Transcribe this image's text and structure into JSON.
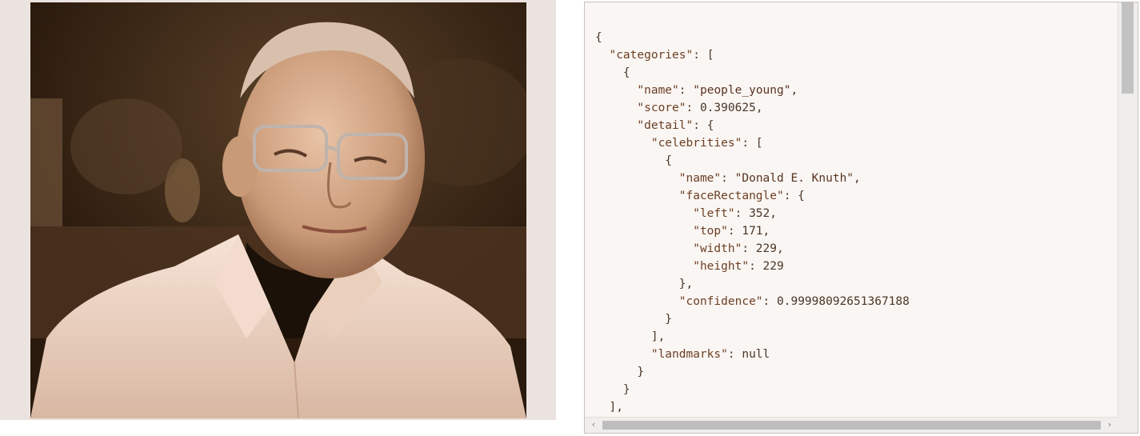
{
  "photo": {
    "subject": "person-portrait"
  },
  "json_viewer": {
    "lines": [
      [
        {
          "t": "p",
          "v": "{"
        }
      ],
      [
        {
          "t": "p",
          "v": "  "
        },
        {
          "t": "k",
          "v": "\"categories\""
        },
        {
          "t": "p",
          "v": ": ["
        }
      ],
      [
        {
          "t": "p",
          "v": "    {"
        }
      ],
      [
        {
          "t": "p",
          "v": "      "
        },
        {
          "t": "k",
          "v": "\"name\""
        },
        {
          "t": "p",
          "v": ": "
        },
        {
          "t": "s",
          "v": "\"people_young\""
        },
        {
          "t": "p",
          "v": ","
        }
      ],
      [
        {
          "t": "p",
          "v": "      "
        },
        {
          "t": "k",
          "v": "\"score\""
        },
        {
          "t": "p",
          "v": ": "
        },
        {
          "t": "n",
          "v": "0.390625"
        },
        {
          "t": "p",
          "v": ","
        }
      ],
      [
        {
          "t": "p",
          "v": "      "
        },
        {
          "t": "k",
          "v": "\"detail\""
        },
        {
          "t": "p",
          "v": ": {"
        }
      ],
      [
        {
          "t": "p",
          "v": "        "
        },
        {
          "t": "k",
          "v": "\"celebrities\""
        },
        {
          "t": "p",
          "v": ": ["
        }
      ],
      [
        {
          "t": "p",
          "v": "          {"
        }
      ],
      [
        {
          "t": "p",
          "v": "            "
        },
        {
          "t": "k",
          "v": "\"name\""
        },
        {
          "t": "p",
          "v": ": "
        },
        {
          "t": "s",
          "v": "\"Donald E. Knuth\""
        },
        {
          "t": "p",
          "v": ","
        }
      ],
      [
        {
          "t": "p",
          "v": "            "
        },
        {
          "t": "k",
          "v": "\"faceRectangle\""
        },
        {
          "t": "p",
          "v": ": {"
        }
      ],
      [
        {
          "t": "p",
          "v": "              "
        },
        {
          "t": "k",
          "v": "\"left\""
        },
        {
          "t": "p",
          "v": ": "
        },
        {
          "t": "n",
          "v": "352"
        },
        {
          "t": "p",
          "v": ","
        }
      ],
      [
        {
          "t": "p",
          "v": "              "
        },
        {
          "t": "k",
          "v": "\"top\""
        },
        {
          "t": "p",
          "v": ": "
        },
        {
          "t": "n",
          "v": "171"
        },
        {
          "t": "p",
          "v": ","
        }
      ],
      [
        {
          "t": "p",
          "v": "              "
        },
        {
          "t": "k",
          "v": "\"width\""
        },
        {
          "t": "p",
          "v": ": "
        },
        {
          "t": "n",
          "v": "229"
        },
        {
          "t": "p",
          "v": ","
        }
      ],
      [
        {
          "t": "p",
          "v": "              "
        },
        {
          "t": "k",
          "v": "\"height\""
        },
        {
          "t": "p",
          "v": ": "
        },
        {
          "t": "n",
          "v": "229"
        }
      ],
      [
        {
          "t": "p",
          "v": "            },"
        }
      ],
      [
        {
          "t": "p",
          "v": "            "
        },
        {
          "t": "k",
          "v": "\"confidence\""
        },
        {
          "t": "p",
          "v": ": "
        },
        {
          "t": "n",
          "v": "0.99998092651367188"
        }
      ],
      [
        {
          "t": "p",
          "v": "          }"
        }
      ],
      [
        {
          "t": "p",
          "v": "        ],"
        }
      ],
      [
        {
          "t": "p",
          "v": "        "
        },
        {
          "t": "k",
          "v": "\"landmarks\""
        },
        {
          "t": "p",
          "v": ": "
        },
        {
          "t": "n",
          "v": "null"
        }
      ],
      [
        {
          "t": "p",
          "v": "      }"
        }
      ],
      [
        {
          "t": "p",
          "v": "    }"
        }
      ],
      [
        {
          "t": "p",
          "v": "  ],"
        }
      ]
    ],
    "scroll": {
      "vertical_position": 0.0,
      "vertical_visible_fraction": 0.22,
      "horizontal_position": 0.0,
      "horizontal_visible_fraction": 1.0
    },
    "scrollbar_arrows": {
      "left": "‹",
      "right": "›"
    }
  }
}
